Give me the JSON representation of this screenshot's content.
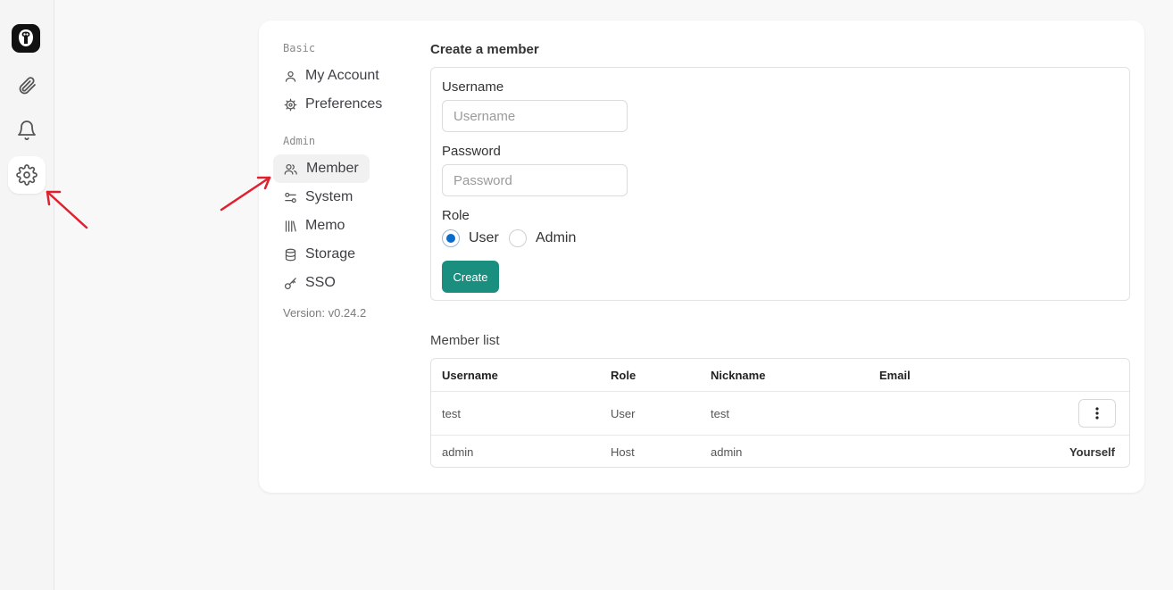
{
  "settings_nav": {
    "basic_label": "Basic",
    "admin_label": "Admin",
    "items": [
      {
        "label": "My Account",
        "icon": "user-icon"
      },
      {
        "label": "Preferences",
        "icon": "cog-icon"
      },
      {
        "label": "Member",
        "icon": "users-icon"
      },
      {
        "label": "System",
        "icon": "settings-sliders-icon"
      },
      {
        "label": "Memo",
        "icon": "library-icon"
      },
      {
        "label": "Storage",
        "icon": "database-icon"
      },
      {
        "label": "SSO",
        "icon": "key-icon"
      }
    ],
    "active": "Member",
    "version": "Version: v0.24.2"
  },
  "create_member": {
    "title": "Create a member",
    "username_label": "Username",
    "username_placeholder": "Username",
    "password_label": "Password",
    "password_placeholder": "Password",
    "role_label": "Role",
    "role_options": [
      "User",
      "Admin"
    ],
    "role_selected": "User",
    "create_label": "Create"
  },
  "member_list": {
    "title": "Member list",
    "columns": [
      "Username",
      "Role",
      "Nickname",
      "Email"
    ],
    "rows": [
      {
        "username": "test",
        "role": "User",
        "nickname": "test",
        "email": ""
      },
      {
        "username": "admin",
        "role": "Host",
        "nickname": "admin",
        "email": "",
        "note": "Yourself"
      }
    ]
  },
  "colors": {
    "accent": "#1a8f80",
    "radio_checked": "#0b6bcb",
    "annotation_arrow": "#e0202e"
  }
}
